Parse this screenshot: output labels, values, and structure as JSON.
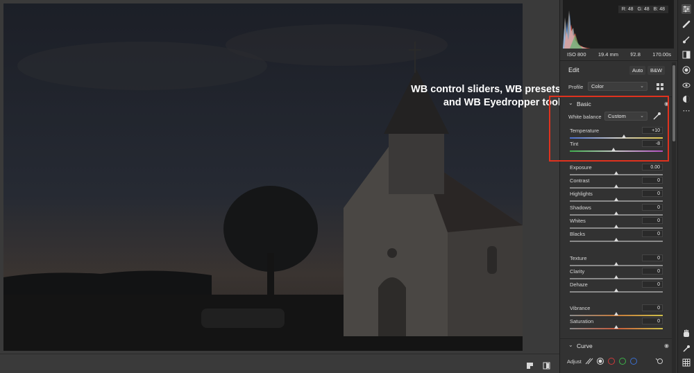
{
  "annotation": {
    "line1": "WB control sliders, WB presets",
    "line2": "and WB Eyedropper tool"
  },
  "histogram": {
    "r_label": "R: 48",
    "g_label": "G: 48",
    "b_label": "B: 48"
  },
  "camera": {
    "iso": "ISO 800",
    "focal": "19.4 mm",
    "aperture": "f/2.8",
    "shutter": "170.00s"
  },
  "edit": {
    "title": "Edit",
    "auto": "Auto",
    "bw": "B&W"
  },
  "profile": {
    "label": "Profile",
    "value": "Color"
  },
  "basic": {
    "title": "Basic",
    "white_balance": {
      "label": "White balance",
      "value": "Custom"
    },
    "sliders": [
      {
        "name": "Temperature",
        "value": "+10",
        "level": 0.58
      },
      {
        "name": "Tint",
        "value": "-8",
        "level": 0.47
      },
      {
        "name": "Exposure",
        "value": "0.00",
        "level": 0.5
      },
      {
        "name": "Contrast",
        "value": "0",
        "level": 0.5
      },
      {
        "name": "Highlights",
        "value": "0",
        "level": 0.5
      },
      {
        "name": "Shadows",
        "value": "0",
        "level": 0.5
      },
      {
        "name": "Whites",
        "value": "0",
        "level": 0.5
      },
      {
        "name": "Blacks",
        "value": "0",
        "level": 0.5
      },
      {
        "name": "Texture",
        "value": "0",
        "level": 0.5
      },
      {
        "name": "Clarity",
        "value": "0",
        "level": 0.5
      },
      {
        "name": "Dehaze",
        "value": "0",
        "level": 0.5
      },
      {
        "name": "Vibrance",
        "value": "0",
        "level": 0.5
      },
      {
        "name": "Saturation",
        "value": "0",
        "level": 0.5
      }
    ]
  },
  "curve": {
    "title": "Curve",
    "adjust_label": "Adjust"
  },
  "colors": {
    "annotation_box": "#e0321e",
    "panel_bg": "#323232",
    "canvas_bg": "#3a3a3a"
  },
  "tools": [
    "sliders-icon",
    "healing-icon",
    "brush-icon",
    "gradient-icon",
    "radial-icon",
    "redeye-icon",
    "presets-icon",
    "more-icon",
    "hand-icon",
    "eyedropper-icon",
    "grid-icon"
  ]
}
